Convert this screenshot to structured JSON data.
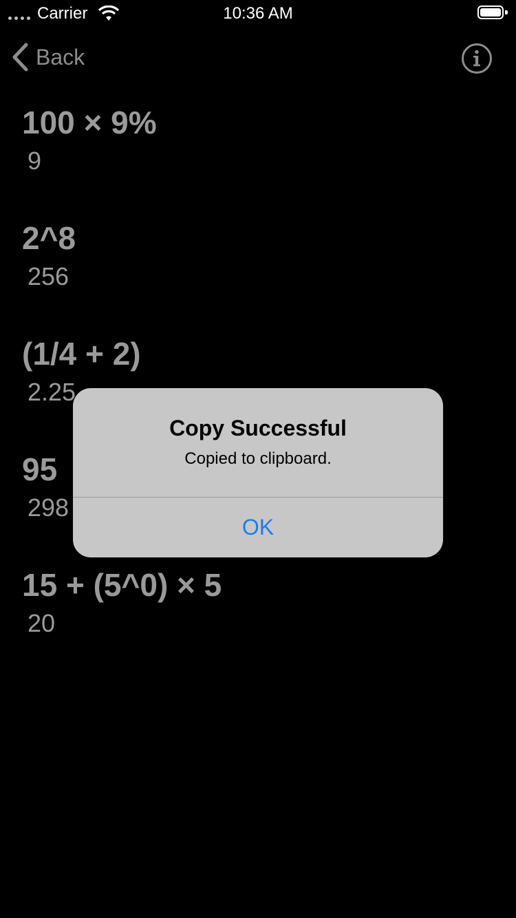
{
  "status_bar": {
    "carrier": "Carrier",
    "time": "10:36 AM"
  },
  "nav": {
    "back_label": "Back",
    "info_icon": "info-circle-icon"
  },
  "calculations": [
    {
      "expression": "100 × 9%",
      "result": "9"
    },
    {
      "expression": "2^8",
      "result": "256"
    },
    {
      "expression": "(1/4 + 2)",
      "result": "2.25"
    },
    {
      "expression": "95",
      "result": "298"
    },
    {
      "expression": "15 + (5^0) × 5",
      "result": "20"
    }
  ],
  "alert": {
    "title": "Copy Successful",
    "message": "Copied to clipboard.",
    "ok_label": "OK"
  },
  "colors": {
    "background": "#000000",
    "alert_background": "#c7c7c7",
    "button_blue": "#1a7ef2",
    "text_gray": "#9a9a9a"
  }
}
